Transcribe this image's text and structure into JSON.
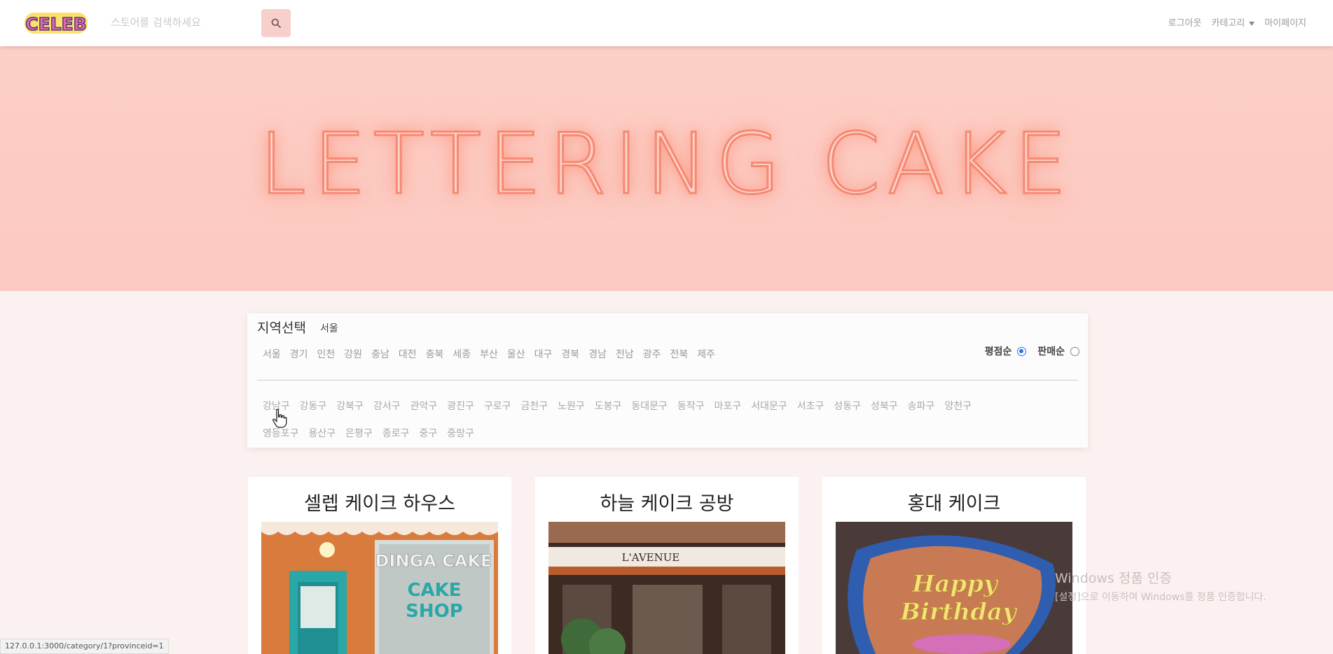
{
  "nav": {
    "logo_text": "CELEB",
    "search_placeholder": "스토어를 검색하세요",
    "logout": "로그아웃",
    "category": "카테고리",
    "mypage": "마이페이지"
  },
  "hero": {
    "title": "LETTERING CAKE"
  },
  "filter": {
    "region_title": "지역선택",
    "selected_region": "서울",
    "provinces": [
      "서울",
      "경기",
      "인천",
      "강원",
      "충남",
      "대전",
      "충북",
      "세종",
      "부산",
      "울산",
      "대구",
      "경북",
      "경남",
      "전남",
      "광주",
      "전북",
      "제주"
    ],
    "sort": {
      "rating": "평점순",
      "sales": "판매순",
      "selected": "rating"
    },
    "districts_row1": [
      "강남구",
      "강동구",
      "강북구",
      "강서구",
      "관악구",
      "광진구",
      "구로구",
      "금천구",
      "노원구",
      "도봉구",
      "동대문구",
      "동작구",
      "마포구",
      "서대문구",
      "서초구",
      "성동구",
      "성북구",
      "송파구",
      "양천구"
    ],
    "districts_row2": [
      "영등포구",
      "용산구",
      "은평구",
      "종로구",
      "중구",
      "중랑구"
    ]
  },
  "stores": [
    {
      "name": "셀렙 케이크 하우스",
      "sign1": "DINGA CAKE",
      "sign2": "CAKE",
      "sign3": "SHOP"
    },
    {
      "name": "하늘 케이크 공방",
      "sign1": "L'AVENUE"
    },
    {
      "name": "홍대 케이크",
      "cake_text1": "Happy",
      "cake_text2": "Birthday"
    }
  ],
  "watermark": {
    "line1": "Windows 정품 인증",
    "line2": "[설정]으로 이동하여 Windows를 정품 인증합니다."
  },
  "status_url": "127.0.0.1:3000/category/1?provinceid=1",
  "colors": {
    "accent": "#f7cfcb",
    "hero_bg": "#fdcfc7",
    "radio_on": "#2b72e6"
  }
}
